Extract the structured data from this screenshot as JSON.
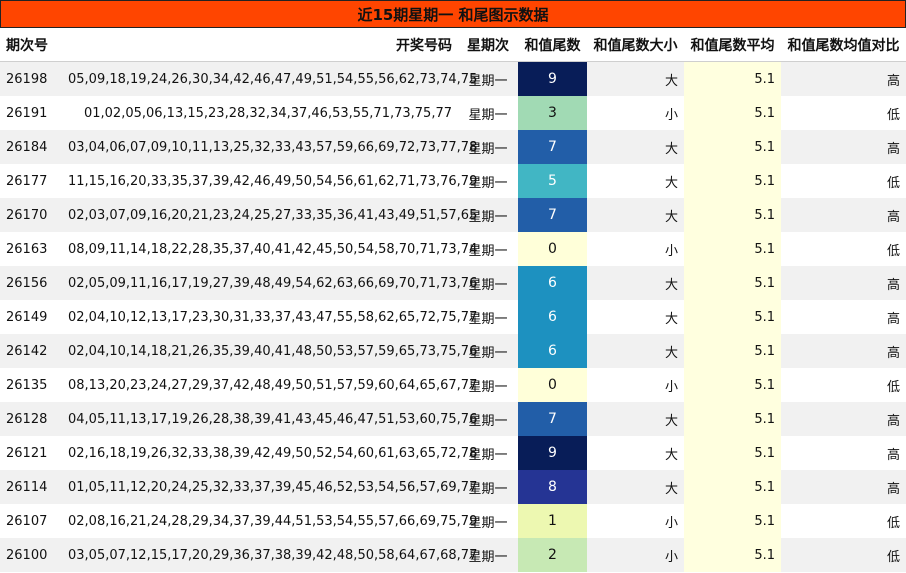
{
  "title": "近15期星期一 和尾图示数据",
  "headers": {
    "issue": "期次号",
    "numbers": "开奖号码",
    "weekday": "星期次",
    "tail": "和值尾数",
    "size": "和值尾数大小",
    "avg": "和值尾数平均",
    "compare": "和值尾数均值对比"
  },
  "colors": {
    "title_bg": "#ff4500",
    "avg_bg": "#ffffdf",
    "tail_scale": {
      "0": "#ffffd9",
      "1": "#edf8b1",
      "2": "#c7e9b4",
      "3": "#a1dab4",
      "5": "#41b6c4",
      "6": "#1d91c0",
      "7": "#225ea8",
      "8": "#253494",
      "9": "#081d58"
    }
  },
  "rows": [
    {
      "issue": "26198",
      "numbers": "05,09,18,19,24,26,30,34,42,46,47,49,51,54,55,56,62,73,74,75",
      "weekday": "星期一",
      "tail": "9",
      "size": "大",
      "avg": "5.1",
      "compare": "高"
    },
    {
      "issue": "26191",
      "numbers": "01,02,05,06,13,15,23,28,32,34,37,46,53,55,71,73,75,77",
      "weekday": "星期一",
      "tail": "3",
      "size": "小",
      "avg": "5.1",
      "compare": "低"
    },
    {
      "issue": "26184",
      "numbers": "03,04,06,07,09,10,11,13,25,32,33,43,57,59,66,69,72,73,77,78",
      "weekday": "星期一",
      "tail": "7",
      "size": "大",
      "avg": "5.1",
      "compare": "高"
    },
    {
      "issue": "26177",
      "numbers": "11,15,16,20,33,35,37,39,42,46,49,50,54,56,61,62,71,73,76,79",
      "weekday": "星期一",
      "tail": "5",
      "size": "大",
      "avg": "5.1",
      "compare": "低"
    },
    {
      "issue": "26170",
      "numbers": "02,03,07,09,16,20,21,23,24,25,27,33,35,36,41,43,49,51,57,65",
      "weekday": "星期一",
      "tail": "7",
      "size": "大",
      "avg": "5.1",
      "compare": "高"
    },
    {
      "issue": "26163",
      "numbers": "08,09,11,14,18,22,28,35,37,40,41,42,45,50,54,58,70,71,73,74",
      "weekday": "星期一",
      "tail": "0",
      "size": "小",
      "avg": "5.1",
      "compare": "低"
    },
    {
      "issue": "26156",
      "numbers": "02,05,09,11,16,17,19,27,39,48,49,54,62,63,66,69,70,71,73,76",
      "weekday": "星期一",
      "tail": "6",
      "size": "大",
      "avg": "5.1",
      "compare": "高"
    },
    {
      "issue": "26149",
      "numbers": "02,04,10,12,13,17,23,30,31,33,37,43,47,55,58,62,65,72,75,77",
      "weekday": "星期一",
      "tail": "6",
      "size": "大",
      "avg": "5.1",
      "compare": "高"
    },
    {
      "issue": "26142",
      "numbers": "02,04,10,14,18,21,26,35,39,40,41,48,50,53,57,59,65,73,75,76",
      "weekday": "星期一",
      "tail": "6",
      "size": "大",
      "avg": "5.1",
      "compare": "高"
    },
    {
      "issue": "26135",
      "numbers": "08,13,20,23,24,27,29,37,42,48,49,50,51,57,59,60,64,65,67,77",
      "weekday": "星期一",
      "tail": "0",
      "size": "小",
      "avg": "5.1",
      "compare": "低"
    },
    {
      "issue": "26128",
      "numbers": "04,05,11,13,17,19,26,28,38,39,41,43,45,46,47,51,53,60,75,76",
      "weekday": "星期一",
      "tail": "7",
      "size": "大",
      "avg": "5.1",
      "compare": "高"
    },
    {
      "issue": "26121",
      "numbers": "02,16,18,19,26,32,33,38,39,42,49,50,52,54,60,61,63,65,72,78",
      "weekday": "星期一",
      "tail": "9",
      "size": "大",
      "avg": "5.1",
      "compare": "高"
    },
    {
      "issue": "26114",
      "numbers": "01,05,11,12,20,24,25,32,33,37,39,45,46,52,53,54,56,57,69,77",
      "weekday": "星期一",
      "tail": "8",
      "size": "大",
      "avg": "5.1",
      "compare": "高"
    },
    {
      "issue": "26107",
      "numbers": "02,08,16,21,24,28,29,34,37,39,44,51,53,54,55,57,66,69,75,79",
      "weekday": "星期一",
      "tail": "1",
      "size": "小",
      "avg": "5.1",
      "compare": "低"
    },
    {
      "issue": "26100",
      "numbers": "03,05,07,12,15,17,20,29,36,37,38,39,42,48,50,58,64,67,68,77",
      "weekday": "星期一",
      "tail": "2",
      "size": "小",
      "avg": "5.1",
      "compare": "低"
    }
  ]
}
